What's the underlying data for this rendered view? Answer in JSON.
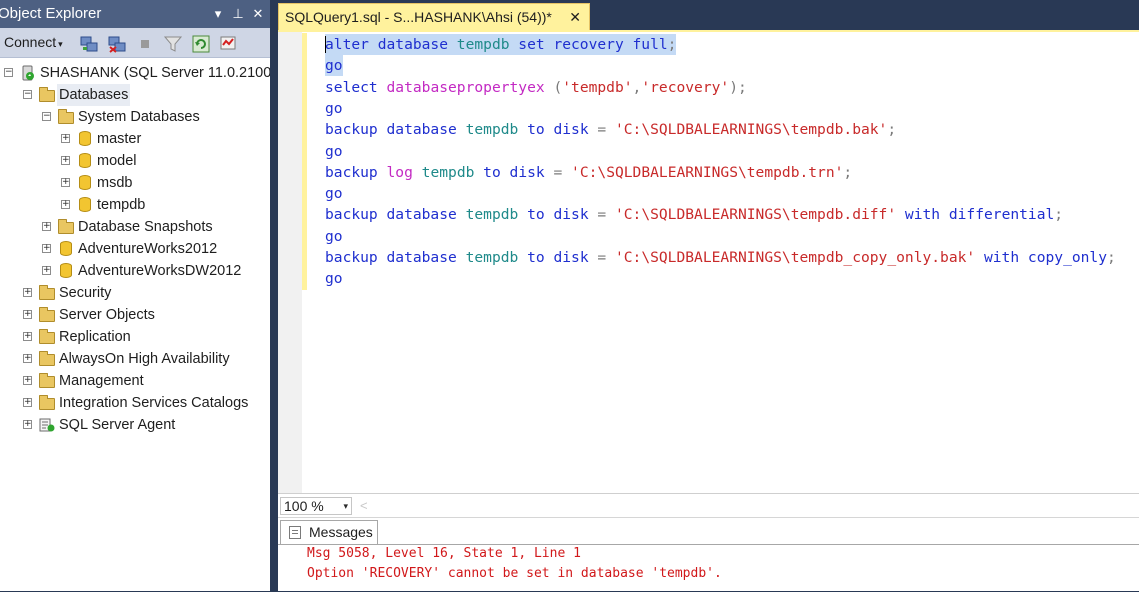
{
  "object_explorer": {
    "title": "Object Explorer",
    "controls": {
      "dropdown": "▾",
      "pin": "⊥",
      "close": "✕"
    },
    "toolbar": {
      "connect_label": "Connect",
      "buttons": [
        "connect-object-explorer-icon",
        "disconnect-icon",
        "stop-icon",
        "filter-icon",
        "refresh-icon",
        "activity-monitor-icon"
      ]
    },
    "tree": [
      {
        "label": "SHASHANK (SQL Server 11.0.2100",
        "icon": "server-icon",
        "expander": "−"
      },
      {
        "label": "Databases",
        "icon": "folder-icon",
        "expander": "−"
      },
      {
        "label": "System Databases",
        "icon": "folder-icon",
        "expander": "−"
      },
      {
        "label": "master",
        "icon": "database-icon",
        "expander": "+"
      },
      {
        "label": "model",
        "icon": "database-icon",
        "expander": "+"
      },
      {
        "label": "msdb",
        "icon": "database-icon",
        "expander": "+"
      },
      {
        "label": "tempdb",
        "icon": "database-icon",
        "expander": "+"
      },
      {
        "label": "Database Snapshots",
        "icon": "folder-icon",
        "expander": "+"
      },
      {
        "label": "AdventureWorks2012",
        "icon": "database-icon",
        "expander": "+"
      },
      {
        "label": "AdventureWorksDW2012",
        "icon": "database-icon",
        "expander": "+"
      },
      {
        "label": "Security",
        "icon": "folder-icon",
        "expander": "+"
      },
      {
        "label": "Server Objects",
        "icon": "folder-icon",
        "expander": "+"
      },
      {
        "label": "Replication",
        "icon": "folder-icon",
        "expander": "+"
      },
      {
        "label": "AlwaysOn High Availability",
        "icon": "folder-icon",
        "expander": "+"
      },
      {
        "label": "Management",
        "icon": "folder-icon",
        "expander": "+"
      },
      {
        "label": "Integration Services Catalogs",
        "icon": "folder-icon",
        "expander": "+"
      },
      {
        "label": "SQL Server Agent",
        "icon": "sql-agent-icon",
        "expander": "+"
      }
    ]
  },
  "editor": {
    "tab_label": "SQLQuery1.sql - S...HASHANK\\Ahsi (54))*",
    "tab_close": "✕",
    "lines": [
      [
        [
          "kw",
          "alter database "
        ],
        [
          "db",
          "tempdb"
        ],
        [
          "kw",
          " set recovery full"
        ],
        [
          "op",
          ";"
        ]
      ],
      [
        [
          "kw",
          "go"
        ]
      ],
      [
        [
          "kw",
          "select "
        ],
        [
          "fn",
          "databasepropertyex"
        ],
        [
          "op",
          " ("
        ],
        [
          "str",
          "'tempdb'"
        ],
        [
          "op",
          ","
        ],
        [
          "str",
          "'recovery'"
        ],
        [
          "op",
          ");"
        ]
      ],
      [
        [
          "kw",
          "go"
        ]
      ],
      [
        [
          "kw",
          "backup database "
        ],
        [
          "db",
          "tempdb"
        ],
        [
          "kw",
          " to disk "
        ],
        [
          "op",
          "= "
        ],
        [
          "str",
          "'C:\\SQLDBALEARNINGS\\tempdb.bak'"
        ],
        [
          "op",
          ";"
        ]
      ],
      [
        [
          "kw",
          "go"
        ]
      ],
      [
        [
          "kw",
          "backup "
        ],
        [
          "fn",
          "log"
        ],
        [
          "kw",
          " "
        ],
        [
          "db",
          "tempdb"
        ],
        [
          "kw",
          " to disk "
        ],
        [
          "op",
          "= "
        ],
        [
          "str",
          "'C:\\SQLDBALEARNINGS\\tempdb.trn'"
        ],
        [
          "op",
          ";"
        ]
      ],
      [
        [
          "kw",
          "go"
        ]
      ],
      [
        [
          "kw",
          "backup database "
        ],
        [
          "db",
          "tempdb"
        ],
        [
          "kw",
          " to disk "
        ],
        [
          "op",
          "= "
        ],
        [
          "str",
          "'C:\\SQLDBALEARNINGS\\tempdb.diff'"
        ],
        [
          "kw",
          " with differential"
        ],
        [
          "op",
          ";"
        ]
      ],
      [
        [
          "kw",
          "go"
        ]
      ],
      [
        [
          "kw",
          "backup database "
        ],
        [
          "db",
          "tempdb"
        ],
        [
          "kw",
          " to disk "
        ],
        [
          "op",
          "= "
        ],
        [
          "str",
          "'C:\\SQLDBALEARNINGS\\tempdb_copy_only.bak'"
        ],
        [
          "kw",
          " with copy_only"
        ],
        [
          "op",
          ";"
        ]
      ],
      [
        [
          "kw",
          "go"
        ]
      ]
    ],
    "zoom": "100 %",
    "zoom_arrow": "▾",
    "scroll_left": "<"
  },
  "results": {
    "tab_label": "Messages",
    "messages": [
      "Msg 5058, Level 16, State 1, Line 1",
      "Option 'RECOVERY' cannot be set in database 'tempdb'."
    ]
  },
  "colors": {
    "window_bg": "#293955",
    "active_tab": "#fff29d",
    "selection": "#c4daf5",
    "error_text": "#d1181a"
  }
}
